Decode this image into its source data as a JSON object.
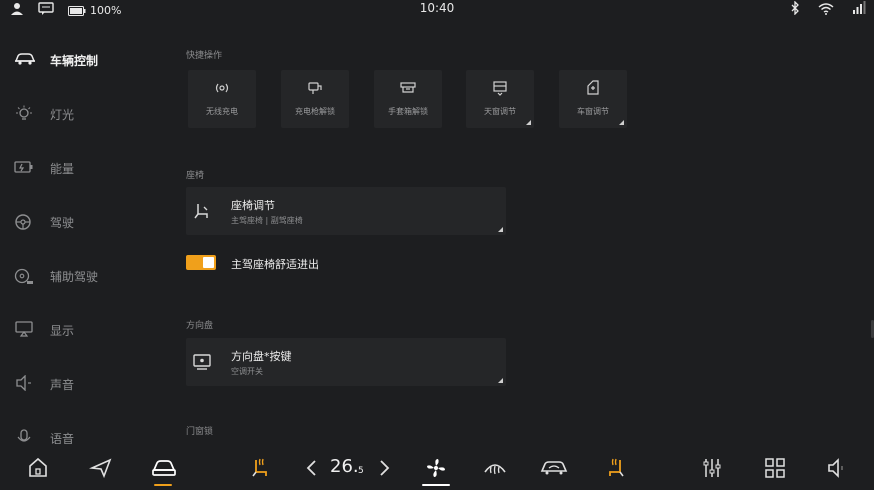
{
  "status_bar": {
    "battery_text": "100%",
    "time": "10:40"
  },
  "sidebar": {
    "items": [
      {
        "label": "车辆控制",
        "icon": "car-icon",
        "active": true
      },
      {
        "label": "灯光",
        "icon": "light-bulb-icon"
      },
      {
        "label": "能量",
        "icon": "battery-icon"
      },
      {
        "label": "驾驶",
        "icon": "steering-wheel-icon"
      },
      {
        "label": "辅助驾驶",
        "icon": "assisted-driving-icon"
      },
      {
        "label": "显示",
        "icon": "display-icon"
      },
      {
        "label": "声音",
        "icon": "speaker-icon"
      },
      {
        "label": "语音",
        "icon": "microphone-icon"
      }
    ]
  },
  "quick_ops": {
    "title": "快捷操作",
    "items": [
      {
        "label": "无线充电",
        "icon": "wireless-charging-icon"
      },
      {
        "label": "充电枪解锁",
        "icon": "charging-gun-icon"
      },
      {
        "label": "手套箱解锁",
        "icon": "glovebox-icon"
      },
      {
        "label": "天窗调节",
        "icon": "sunroof-icon"
      },
      {
        "label": "车窗调节",
        "icon": "window-icon"
      }
    ]
  },
  "seat": {
    "section_title": "座椅",
    "card_title": "座椅调节",
    "card_sub": "主驾座椅 | 副驾座椅",
    "toggle_label": "主驾座椅舒适进出",
    "toggle_on": true
  },
  "steering": {
    "section_title": "方向盘",
    "card_title": "方向盘*按键",
    "card_sub": "空调开关"
  },
  "door": {
    "section_title": "门窗锁"
  },
  "dock": {
    "temperature": "26.",
    "temperature_decimal": "5",
    "accent": "#f0a01b"
  }
}
